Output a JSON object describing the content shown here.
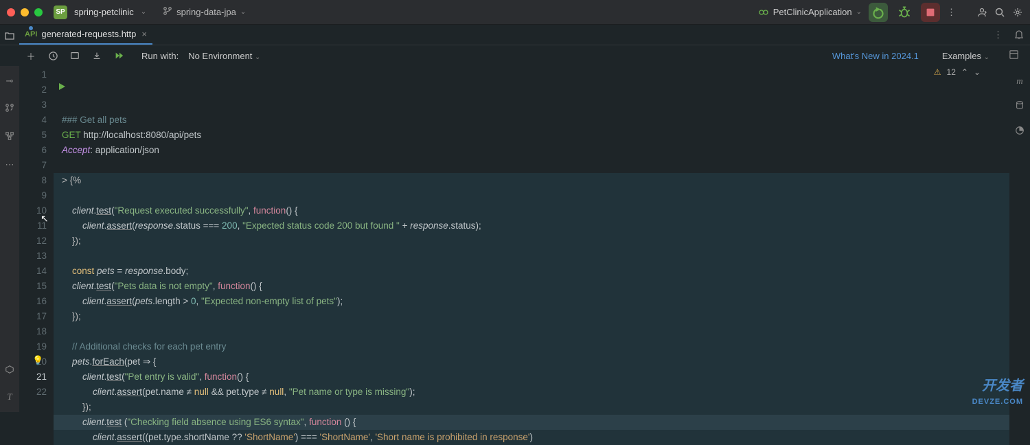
{
  "titlebar": {
    "project_badge": "SP",
    "project_name": "spring-petclinic",
    "branch": "spring-data-jpa",
    "run_config": "PetClinicApplication"
  },
  "tab": {
    "filename": "generated-requests.http"
  },
  "toolbar": {
    "runwith_label": "Run with:",
    "environment": "No Environment",
    "whatsnew": "What's New in 2024.1",
    "examples": "Examples"
  },
  "status": {
    "warnings": "12"
  },
  "code": {
    "lines": [
      {
        "n": "1",
        "text": "### Get all pets",
        "cls": "c-comment"
      },
      {
        "n": "2",
        "tokens": [
          {
            "t": "GET ",
            "c": "c-method-get"
          },
          {
            "t": "http://localhost:8080/api/pets",
            "c": "c-url"
          }
        ]
      },
      {
        "n": "3",
        "tokens": [
          {
            "t": "Accept",
            "c": "c-header"
          },
          {
            "t": ": ",
            "c": "c-op"
          },
          {
            "t": "application/json",
            "c": "c-hval"
          }
        ]
      },
      {
        "n": "4",
        "text": ""
      },
      {
        "n": "5",
        "text": "> {%",
        "blk": true
      },
      {
        "n": "6",
        "text": "",
        "blk": true
      },
      {
        "n": "7",
        "blk": true,
        "tokens": [
          {
            "t": "    "
          },
          {
            "t": "client",
            "c": "c-it"
          },
          {
            "t": ".",
            "c": "c-op"
          },
          {
            "t": "test",
            "c": "c-prop-u"
          },
          {
            "t": "(",
            "c": "c-op"
          },
          {
            "t": "\"Request executed successfully\"",
            "c": "c-str"
          },
          {
            "t": ", ",
            "c": "c-op"
          },
          {
            "t": "function",
            "c": "c-fn"
          },
          {
            "t": "() {",
            "c": "c-op"
          }
        ]
      },
      {
        "n": "8",
        "blk": true,
        "tokens": [
          {
            "t": "        "
          },
          {
            "t": "client",
            "c": "c-it"
          },
          {
            "t": ".",
            "c": "c-op"
          },
          {
            "t": "assert",
            "c": "c-prop-u"
          },
          {
            "t": "(",
            "c": "c-op"
          },
          {
            "t": "response",
            "c": "c-it"
          },
          {
            "t": ".status ",
            "c": "c-prop"
          },
          {
            "t": "=== ",
            "c": "c-op"
          },
          {
            "t": "200",
            "c": "c-num"
          },
          {
            "t": ", ",
            "c": "c-op"
          },
          {
            "t": "\"Expected status code 200 but found \"",
            "c": "c-str"
          },
          {
            "t": " + ",
            "c": "c-op"
          },
          {
            "t": "response",
            "c": "c-it"
          },
          {
            "t": ".status);",
            "c": "c-prop"
          }
        ]
      },
      {
        "n": "9",
        "blk": true,
        "text": "    });"
      },
      {
        "n": "10",
        "blk": true,
        "text": ""
      },
      {
        "n": "11",
        "blk": true,
        "tokens": [
          {
            "t": "    "
          },
          {
            "t": "const ",
            "c": "c-const"
          },
          {
            "t": "pets",
            "c": "c-it"
          },
          {
            "t": " = ",
            "c": "c-op"
          },
          {
            "t": "response",
            "c": "c-it"
          },
          {
            "t": ".body;",
            "c": "c-prop"
          }
        ]
      },
      {
        "n": "12",
        "blk": true,
        "tokens": [
          {
            "t": "    "
          },
          {
            "t": "client",
            "c": "c-it"
          },
          {
            "t": ".",
            "c": "c-op"
          },
          {
            "t": "test",
            "c": "c-prop-u"
          },
          {
            "t": "(",
            "c": "c-op"
          },
          {
            "t": "\"Pets data is not empty\"",
            "c": "c-str"
          },
          {
            "t": ", ",
            "c": "c-op"
          },
          {
            "t": "function",
            "c": "c-fn"
          },
          {
            "t": "() {",
            "c": "c-op"
          }
        ]
      },
      {
        "n": "13",
        "blk": true,
        "tokens": [
          {
            "t": "        "
          },
          {
            "t": "client",
            "c": "c-it"
          },
          {
            "t": ".",
            "c": "c-op"
          },
          {
            "t": "assert",
            "c": "c-prop-u"
          },
          {
            "t": "(",
            "c": "c-op"
          },
          {
            "t": "pets",
            "c": "c-it"
          },
          {
            "t": ".length > ",
            "c": "c-prop"
          },
          {
            "t": "0",
            "c": "c-num"
          },
          {
            "t": ", ",
            "c": "c-op"
          },
          {
            "t": "\"Expected non-empty list of pets\"",
            "c": "c-str"
          },
          {
            "t": ");",
            "c": "c-op"
          }
        ]
      },
      {
        "n": "14",
        "blk": true,
        "text": "    });"
      },
      {
        "n": "15",
        "blk": true,
        "text": ""
      },
      {
        "n": "16",
        "blk": true,
        "tokens": [
          {
            "t": "    "
          },
          {
            "t": "// Additional checks for each pet entry",
            "c": "c-comment"
          }
        ]
      },
      {
        "n": "17",
        "blk": true,
        "tokens": [
          {
            "t": "    "
          },
          {
            "t": "pets",
            "c": "c-it"
          },
          {
            "t": ".",
            "c": "c-op"
          },
          {
            "t": "forEach",
            "c": "c-prop-u"
          },
          {
            "t": "(pet ",
            "c": "c-op"
          },
          {
            "t": "⇒",
            "c": "c-arrow"
          },
          {
            "t": " {",
            "c": "c-op"
          }
        ]
      },
      {
        "n": "18",
        "blk": true,
        "tokens": [
          {
            "t": "        "
          },
          {
            "t": "client",
            "c": "c-it"
          },
          {
            "t": ".",
            "c": "c-op"
          },
          {
            "t": "test",
            "c": "c-prop-u"
          },
          {
            "t": "(",
            "c": "c-op"
          },
          {
            "t": "\"Pet entry is valid\"",
            "c": "c-str"
          },
          {
            "t": ", ",
            "c": "c-op"
          },
          {
            "t": "function",
            "c": "c-fn"
          },
          {
            "t": "() {",
            "c": "c-op"
          }
        ]
      },
      {
        "n": "19",
        "blk": true,
        "tokens": [
          {
            "t": "            "
          },
          {
            "t": "client",
            "c": "c-it"
          },
          {
            "t": ".",
            "c": "c-op"
          },
          {
            "t": "assert",
            "c": "c-prop-u"
          },
          {
            "t": "(pet.name ",
            "c": "c-op"
          },
          {
            "t": "≠",
            "c": "c-op"
          },
          {
            "t": " ",
            "c": "c-op"
          },
          {
            "t": "null",
            "c": "c-const"
          },
          {
            "t": " && pet.type ",
            "c": "c-op"
          },
          {
            "t": "≠",
            "c": "c-op"
          },
          {
            "t": " ",
            "c": "c-op"
          },
          {
            "t": "null",
            "c": "c-const"
          },
          {
            "t": ", ",
            "c": "c-op"
          },
          {
            "t": "\"Pet name or type is missing\"",
            "c": "c-str"
          },
          {
            "t": ");",
            "c": "c-op"
          }
        ]
      },
      {
        "n": "20",
        "blk": true,
        "text": "        });"
      },
      {
        "n": "21",
        "blk": true,
        "active": true,
        "tokens": [
          {
            "t": "        "
          },
          {
            "t": "client",
            "c": "c-it"
          },
          {
            "t": ".",
            "c": "c-op"
          },
          {
            "t": "test",
            "c": "c-prop-u"
          },
          {
            "t": " (",
            "c": "c-op"
          },
          {
            "t": "\"Checking field absence using ES6 syntax\"",
            "c": "c-str"
          },
          {
            "t": ", ",
            "c": "c-op"
          },
          {
            "t": "function ",
            "c": "c-fn"
          },
          {
            "t": "() {",
            "c": "c-op"
          }
        ]
      },
      {
        "n": "22",
        "blk": true,
        "tokens": [
          {
            "t": "            "
          },
          {
            "t": "client",
            "c": "c-it"
          },
          {
            "t": ".",
            "c": "c-op"
          },
          {
            "t": "assert",
            "c": "c-prop-u"
          },
          {
            "t": "((pet.type.shortName ?? ",
            "c": "c-op"
          },
          {
            "t": "'ShortName'",
            "c": "c-strq"
          },
          {
            "t": ") ",
            "c": "c-op"
          },
          {
            "t": "===",
            "c": "c-op"
          },
          {
            "t": " ",
            "c": "c-op"
          },
          {
            "t": "'ShortName'",
            "c": "c-strq"
          },
          {
            "t": ", ",
            "c": "c-op"
          },
          {
            "t": "'Short name is prohibited in response'",
            "c": "c-strq"
          },
          {
            "t": ")",
            "c": "c-op"
          }
        ]
      }
    ]
  },
  "watermark": {
    "line1": "开发者",
    "line2": "DEVZE.COM"
  }
}
